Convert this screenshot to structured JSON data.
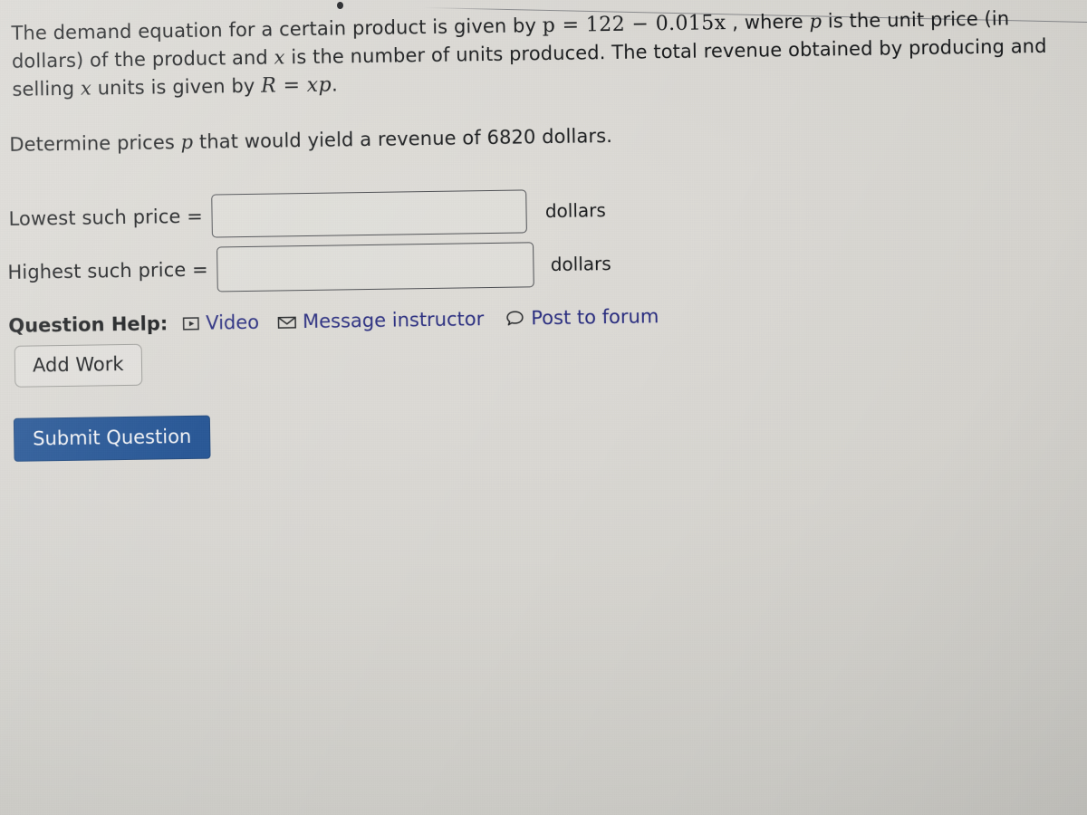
{
  "question": {
    "prompt_part1": "The demand equation for a certain product is given by ",
    "equation_p": "p = 122 − 0.015x",
    "prompt_part2": " , where ",
    "var_p": "p",
    "prompt_part3": " is the unit price (in dollars) of the product and ",
    "var_x": "x",
    "prompt_part4": " is the number of units produced. The total revenue obtained by producing and selling ",
    "var_x2": "x",
    "prompt_part5": " units is given by ",
    "equation_r": "R = xp",
    "prompt_part6": ".",
    "determine_prefix": "Determine prices ",
    "determine_var": "p",
    "determine_suffix": " that would yield a revenue of 6820 dollars.",
    "revenue_target": "6820"
  },
  "answers": {
    "lowest": {
      "label": "Lowest such price =",
      "value": "",
      "placeholder": "",
      "unit": "dollars"
    },
    "highest": {
      "label": "Highest such price =",
      "value": "",
      "placeholder": "",
      "unit": "dollars"
    }
  },
  "help": {
    "label": "Question Help:",
    "links": [
      {
        "text": "Video",
        "icon": "video-play-icon"
      },
      {
        "text": "Message instructor",
        "icon": "envelope-icon"
      },
      {
        "text": "Post to forum",
        "icon": "speech-bubble-icon"
      }
    ]
  },
  "actions": {
    "add_work": "Add Work",
    "submit": "Submit Question"
  },
  "colors": {
    "page_background": "#d7d6d1",
    "text": "#16181a",
    "link": "#262a7e",
    "submit_background": "#1d4f91",
    "submit_text": "#f2f3f6",
    "input_border": "#4a4c50"
  }
}
